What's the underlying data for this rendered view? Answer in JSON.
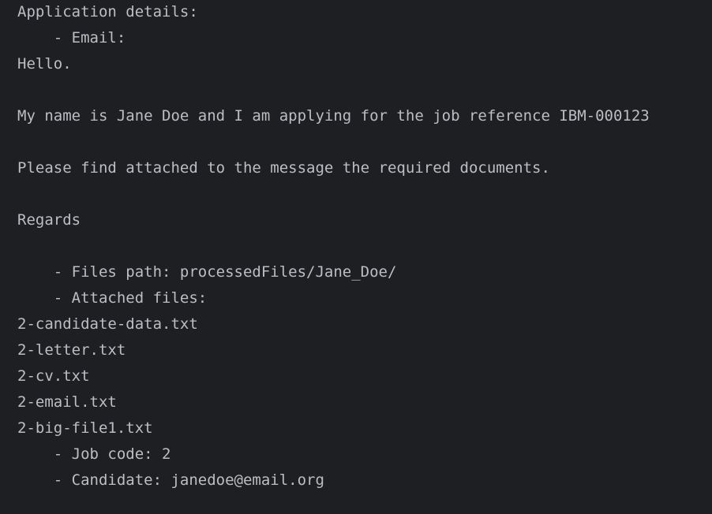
{
  "console": {
    "lines": [
      "Application details:",
      "    - Email:",
      "Hello.",
      "",
      "My name is Jane Doe and I am applying for the job reference IBM-000123",
      "",
      "Please find attached to the message the required documents.",
      "",
      "Regards",
      "",
      "    - Files path: processedFiles/Jane_Doe/",
      "    - Attached files:",
      "2-candidate-data.txt",
      "2-letter.txt",
      "2-cv.txt",
      "2-email.txt",
      "2-big-file1.txt",
      "    - Job code: 2",
      "    - Candidate: janedoe@email.org"
    ]
  }
}
